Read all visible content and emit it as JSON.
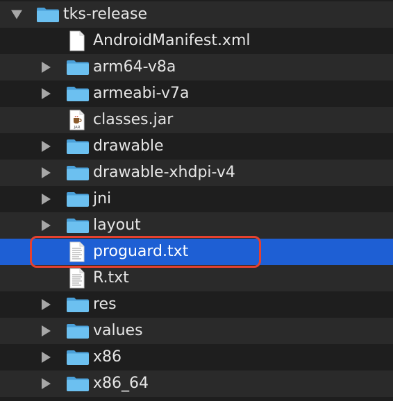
{
  "items": [
    {
      "label": "tks-release",
      "type": "folder",
      "disclosure": "open"
    },
    {
      "label": "AndroidManifest.xml",
      "type": "file",
      "disclosure": "none"
    },
    {
      "label": "arm64-v8a",
      "type": "folder",
      "disclosure": "closed"
    },
    {
      "label": "armeabi-v7a",
      "type": "folder",
      "disclosure": "closed"
    },
    {
      "label": "classes.jar",
      "type": "jar",
      "disclosure": "none"
    },
    {
      "label": "drawable",
      "type": "folder",
      "disclosure": "closed"
    },
    {
      "label": "drawable-xhdpi-v4",
      "type": "folder",
      "disclosure": "closed"
    },
    {
      "label": "jni",
      "type": "folder",
      "disclosure": "closed"
    },
    {
      "label": "layout",
      "type": "folder",
      "disclosure": "closed"
    },
    {
      "label": "proguard.txt",
      "type": "text",
      "disclosure": "none",
      "selected": true
    },
    {
      "label": "R.txt",
      "type": "text",
      "disclosure": "none"
    },
    {
      "label": "res",
      "type": "folder",
      "disclosure": "closed"
    },
    {
      "label": "values",
      "type": "folder",
      "disclosure": "closed"
    },
    {
      "label": "x86",
      "type": "folder",
      "disclosure": "closed"
    },
    {
      "label": "x86_64",
      "type": "folder",
      "disclosure": "closed"
    }
  ],
  "jar_icon_text": "JAR",
  "colors": {
    "selection": "#1e5fd4",
    "highlight_border": "#e5412f",
    "folder": "#5fb4e8"
  },
  "icons": {
    "folder": "folder-icon",
    "file": "document-icon",
    "text": "text-file-icon",
    "jar": "jar-file-icon",
    "disclosure_open": "disclosure-open-icon",
    "disclosure_closed": "disclosure-closed-icon"
  }
}
